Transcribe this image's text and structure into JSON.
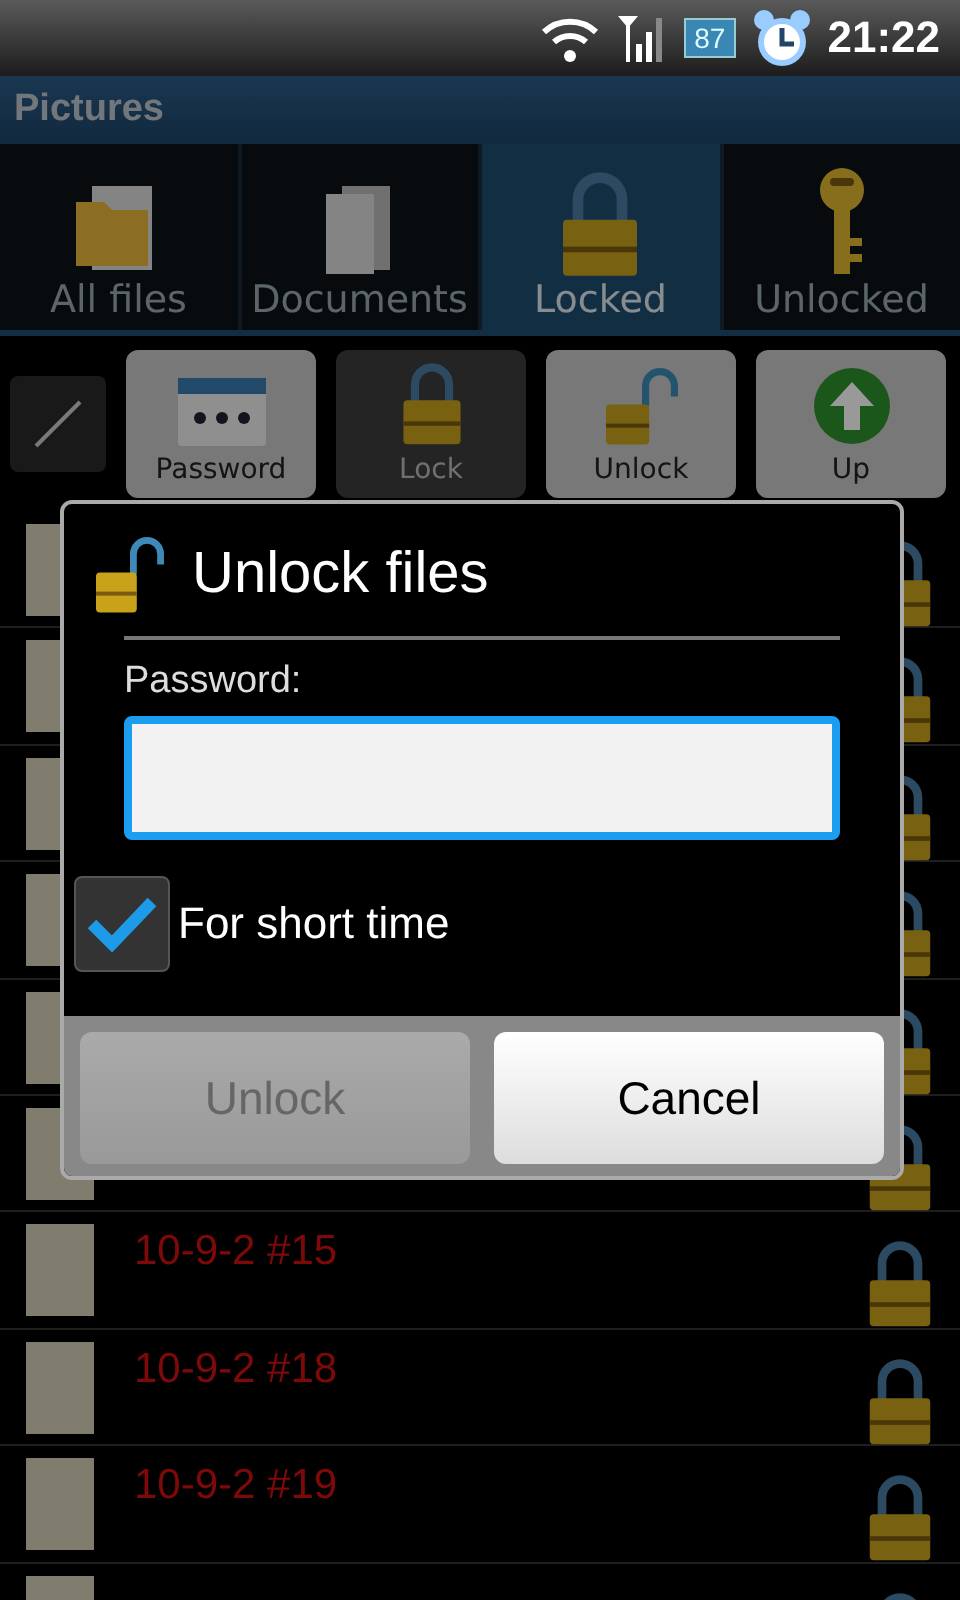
{
  "status_bar": {
    "battery": "87",
    "time": "21:22"
  },
  "title": "Pictures",
  "tabs": [
    {
      "kind": "folder",
      "label": "All files",
      "selected": false
    },
    {
      "kind": "documents",
      "label": "Documents",
      "selected": false
    },
    {
      "kind": "locked",
      "label": "Locked",
      "selected": true
    },
    {
      "kind": "key",
      "label": "Unlocked",
      "selected": false
    }
  ],
  "toolbar": [
    {
      "kind": "password",
      "label": "Password",
      "disabled": false
    },
    {
      "kind": "lock",
      "label": "Lock",
      "disabled": true
    },
    {
      "kind": "unlock",
      "label": "Unlock",
      "disabled": false
    },
    {
      "kind": "up",
      "label": "Up",
      "disabled": false
    }
  ],
  "files": [
    {
      "locked": true
    },
    {
      "locked": true
    },
    {
      "locked": true
    },
    {
      "locked": true
    },
    {
      "locked": true
    },
    {
      "locked": true
    },
    {
      "title": "10-9-2 #15",
      "locked": true
    },
    {
      "title": "10-9-2 #18",
      "locked": true
    },
    {
      "title": "10-9-2 #19",
      "locked": true
    },
    {
      "locked": true
    }
  ],
  "dialog": {
    "title": "Unlock files",
    "field_label": "Password:",
    "field_focused": true,
    "checkbox": {
      "label": "For short time",
      "checked": true
    },
    "buttons": [
      {
        "label": "Unlock",
        "disabled": true
      },
      {
        "label": "Cancel",
        "disabled": false
      }
    ]
  }
}
